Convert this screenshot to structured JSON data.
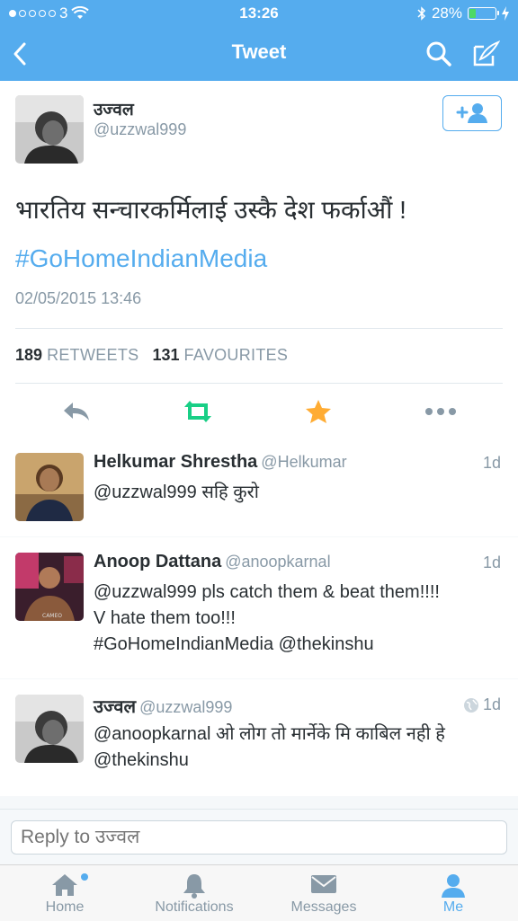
{
  "status_bar": {
    "carrier": "3",
    "time": "13:26",
    "battery": "28%",
    "battery_level": 0.28
  },
  "header": {
    "title": "Tweet"
  },
  "tweet": {
    "author_name": "उज्वल",
    "author_handle": "@uzzwal999",
    "text": "भारतिय सन्चारकर्मिलाई उस्कै देश फर्काऔं !",
    "hashtag": "#GoHomeIndianMedia",
    "date": "02/05/2015 13:46",
    "retweets_count": "189",
    "retweets_label": "RETWEETS",
    "favourites_count": "131",
    "favourites_label": "FAVOURITES"
  },
  "replies": [
    {
      "name": "Helkumar Shrestha",
      "handle": "@Helkumar",
      "time": "1d",
      "lines": [
        "@uzzwal999  सहि कुरो"
      ]
    },
    {
      "name": "Anoop Dattana",
      "handle": "@anoopkarnal",
      "time": "1d",
      "lines": [
        "@uzzwal999 pls catch them & beat them!!!!",
        "V hate them too!!!",
        "#GoHomeIndianMedia  @thekinshu"
      ]
    },
    {
      "name": "उज्वल",
      "handle": "@uzzwal999",
      "time": "1d",
      "lines": [
        "@anoopkarnal ओ लोग तो मार्नेके  मि काबिल नही हे",
        "@thekinshu"
      ]
    }
  ],
  "reply_bar": {
    "placeholder": "Reply to उज्वल"
  },
  "tabs": [
    {
      "label": "Home",
      "icon": "home-icon"
    },
    {
      "label": "Notifications",
      "icon": "bell-icon"
    },
    {
      "label": "Messages",
      "icon": "envelope-icon"
    },
    {
      "label": "Me",
      "icon": "person-icon"
    }
  ],
  "colors": {
    "accent": "#55acee",
    "retweet": "#19cf86",
    "favourite": "#ffac33"
  }
}
